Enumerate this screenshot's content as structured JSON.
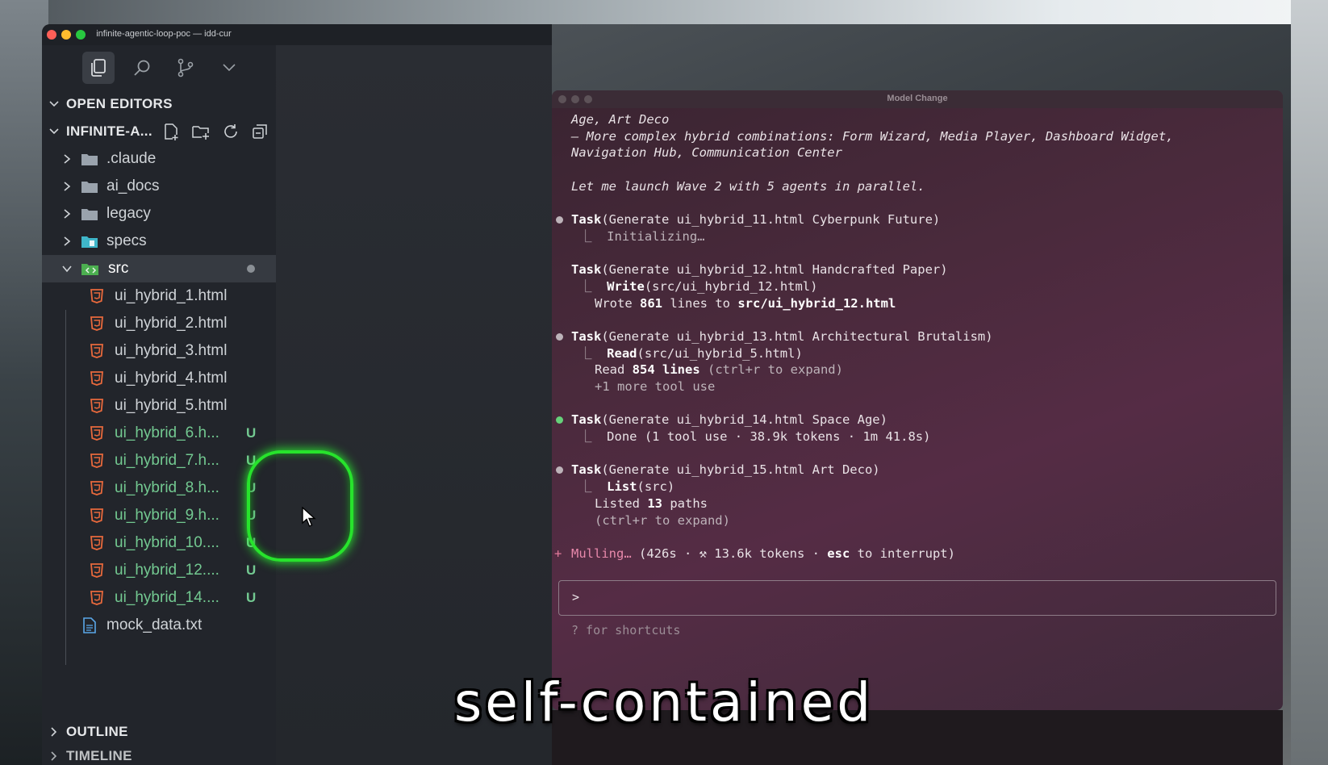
{
  "window": {
    "title": "infinite-agentic-loop-poc — idd-cur"
  },
  "activity_bar": {
    "icons": [
      "files-icon",
      "search-icon",
      "source-control-icon",
      "chevron-down-icon"
    ]
  },
  "sidebar": {
    "open_editors_label": "OPEN EDITORS",
    "workspace_label": "INFINITE-A...",
    "outline_label": "OUTLINE",
    "timeline_label": "TIMELINE",
    "folders": [
      {
        "name": ".claude"
      },
      {
        "name": "ai_docs"
      },
      {
        "name": "legacy"
      },
      {
        "name": "specs"
      }
    ],
    "src_folder": "src",
    "files": [
      {
        "name": "ui_hybrid_1.html",
        "status": ""
      },
      {
        "name": "ui_hybrid_2.html",
        "status": ""
      },
      {
        "name": "ui_hybrid_3.html",
        "status": ""
      },
      {
        "name": "ui_hybrid_4.html",
        "status": ""
      },
      {
        "name": "ui_hybrid_5.html",
        "status": ""
      },
      {
        "name": "ui_hybrid_6.h...",
        "status": "U"
      },
      {
        "name": "ui_hybrid_7.h...",
        "status": "U"
      },
      {
        "name": "ui_hybrid_8.h...",
        "status": "U"
      },
      {
        "name": "ui_hybrid_9.h...",
        "status": "U"
      },
      {
        "name": "ui_hybrid_10....",
        "status": "U"
      },
      {
        "name": "ui_hybrid_12....",
        "status": "U"
      },
      {
        "name": "ui_hybrid_14....",
        "status": "U"
      }
    ],
    "extra_file": "mock_data.txt"
  },
  "terminal": {
    "title": "Model Change",
    "lines": {
      "l1": "Age, Art Deco",
      "l2": "– More complex hybrid combinations: Form Wizard, Media Player, Dashboard Widget,",
      "l3": "Navigation Hub, Communication Center",
      "l4": "Let me launch Wave 2 with 5 agents in parallel.",
      "t11_head": "Task",
      "t11_args": "(Generate ui_hybrid_11.html Cyberpunk Future)",
      "t11_sub": "⎿  Initializing…",
      "t12_head": "Task",
      "t12_args": "(Generate ui_hybrid_12.html Handcrafted Paper)",
      "t12_sub_tool": "Write",
      "t12_sub_args": "(src/ui_hybrid_12.html)",
      "t12_res_a": "Wrote ",
      "t12_res_b": "861",
      "t12_res_c": " lines to ",
      "t12_res_d": "src/ui_hybrid_12.html",
      "t13_head": "Task",
      "t13_args": "(Generate ui_hybrid_13.html Architectural Brutalism)",
      "t13_sub_tool": "Read",
      "t13_sub_args": "(src/ui_hybrid_5.html)",
      "t13_res_a": "Read ",
      "t13_res_b": "854",
      "t13_res_c": " lines",
      "t13_res_d": " (ctrl+r to expand)",
      "t13_more": "+1 more tool use",
      "t14_head": "Task",
      "t14_args": "(Generate ui_hybrid_14.html Space Age)",
      "t14_sub": "Done (1 tool use · 38.9k tokens · 1m 41.8s)",
      "t15_head": "Task",
      "t15_args": "(Generate ui_hybrid_15.html Art Deco)",
      "t15_sub_tool": "List",
      "t15_sub_args": "(src)",
      "t15_res_a": "Listed ",
      "t15_res_b": "13",
      "t15_res_c": " paths",
      "t15_res_d": "(ctrl+r to expand)",
      "status_star": "+",
      "status_word": "Mulling…",
      "status_rest_a": " (426s · ⚒ 13.6k tokens · ",
      "status_esc": "esc",
      "status_rest_b": " to interrupt)"
    },
    "prompt": ">",
    "shortcuts": "? for shortcuts"
  },
  "caption": "self-contained",
  "colors": {
    "untracked": "#73c991",
    "html_icon": "#e8693c",
    "highlight": "#27e32c"
  }
}
